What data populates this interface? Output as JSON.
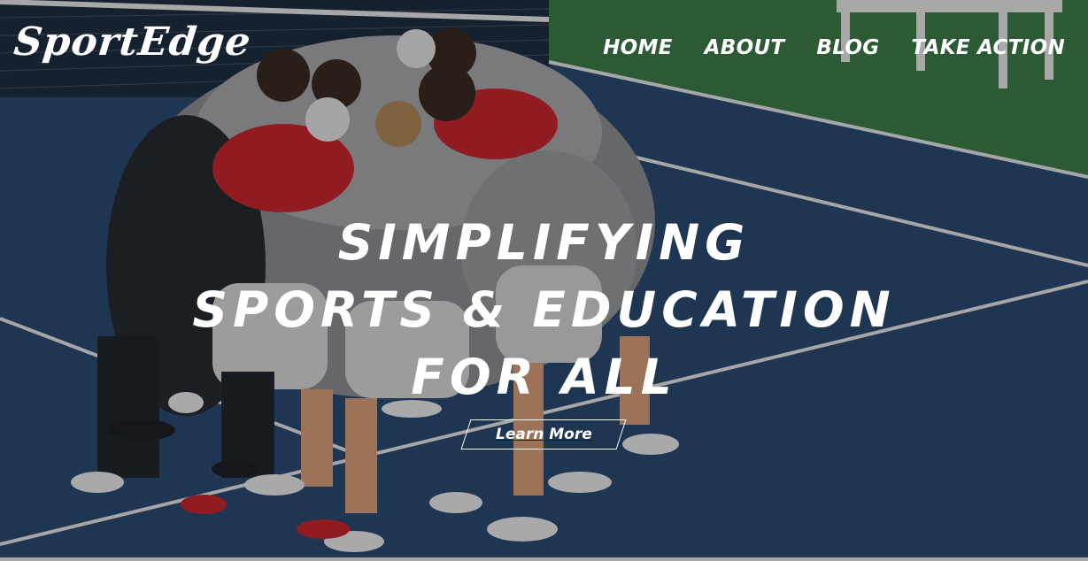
{
  "brand": {
    "logo_text": "SportEdge"
  },
  "nav": {
    "home": "HOME",
    "about": "ABOUT",
    "blog": "BLOG",
    "take_action": "TAKE ACTION"
  },
  "hero": {
    "headline_line1": "SIMPLIFYING",
    "headline_line2": "SPORTS & EDUCATION",
    "headline_line3": "FOR ALL",
    "cta_label": "Learn More",
    "image_icon": "team-huddle-photo"
  },
  "colors": {
    "court_blue": "#2b4a72",
    "court_green": "#3b7d45",
    "text": "#ffffff"
  }
}
